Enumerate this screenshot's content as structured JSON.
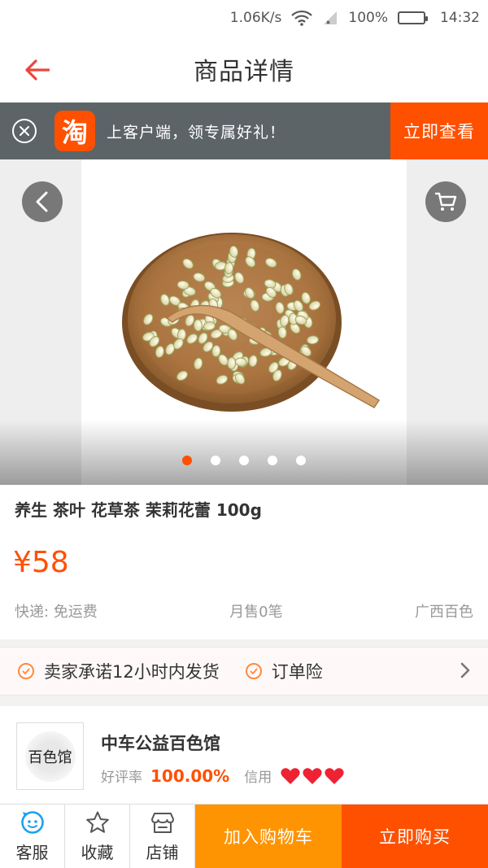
{
  "status_bar": {
    "speed": "1.06K/s",
    "battery": "100%",
    "battery_level": 1.0,
    "time": "14:32",
    "icons": [
      "wifi-icon",
      "signal-icon",
      "battery-icon"
    ]
  },
  "header": {
    "title": "商品详情",
    "back_icon": "back-arrow-icon"
  },
  "app_banner": {
    "logo_char": "淘",
    "text": "上客户端，领专属好礼！",
    "open_label": "立即查看"
  },
  "carousel": {
    "image": "jasmine-bud-tea-in-wooden-bowl",
    "slide_count": 5,
    "active_slide": 1
  },
  "product": {
    "title": "养生 茶叶 花草茶 茉莉花蕾 100g",
    "price": "¥58",
    "shipping": "快递: 免运费",
    "monthly_sales": "月售0笔",
    "location": "广西百色"
  },
  "guarantees": [
    {
      "label": "卖家承诺12小时内发货"
    },
    {
      "label": "订单险"
    }
  ],
  "shop": {
    "name": "中车公益百色馆",
    "logo_text": "百色馆",
    "rating_label": "好评率",
    "rating_value": "100.00%",
    "credit_label": "信用",
    "credit_hearts": 3
  },
  "bottom_bar": {
    "service_label": "客服",
    "favorite_label": "收藏",
    "shop_label": "店铺",
    "add_cart_label": "加入购物车",
    "buy_label": "立即购买"
  },
  "colors": {
    "accent": "#ff5000",
    "add_cart": "#ff9402",
    "back_arrow": "#e8473f",
    "banner_bg": "#5d6468",
    "service_icon": "#1ea0f0",
    "heart": "#ee2233"
  }
}
